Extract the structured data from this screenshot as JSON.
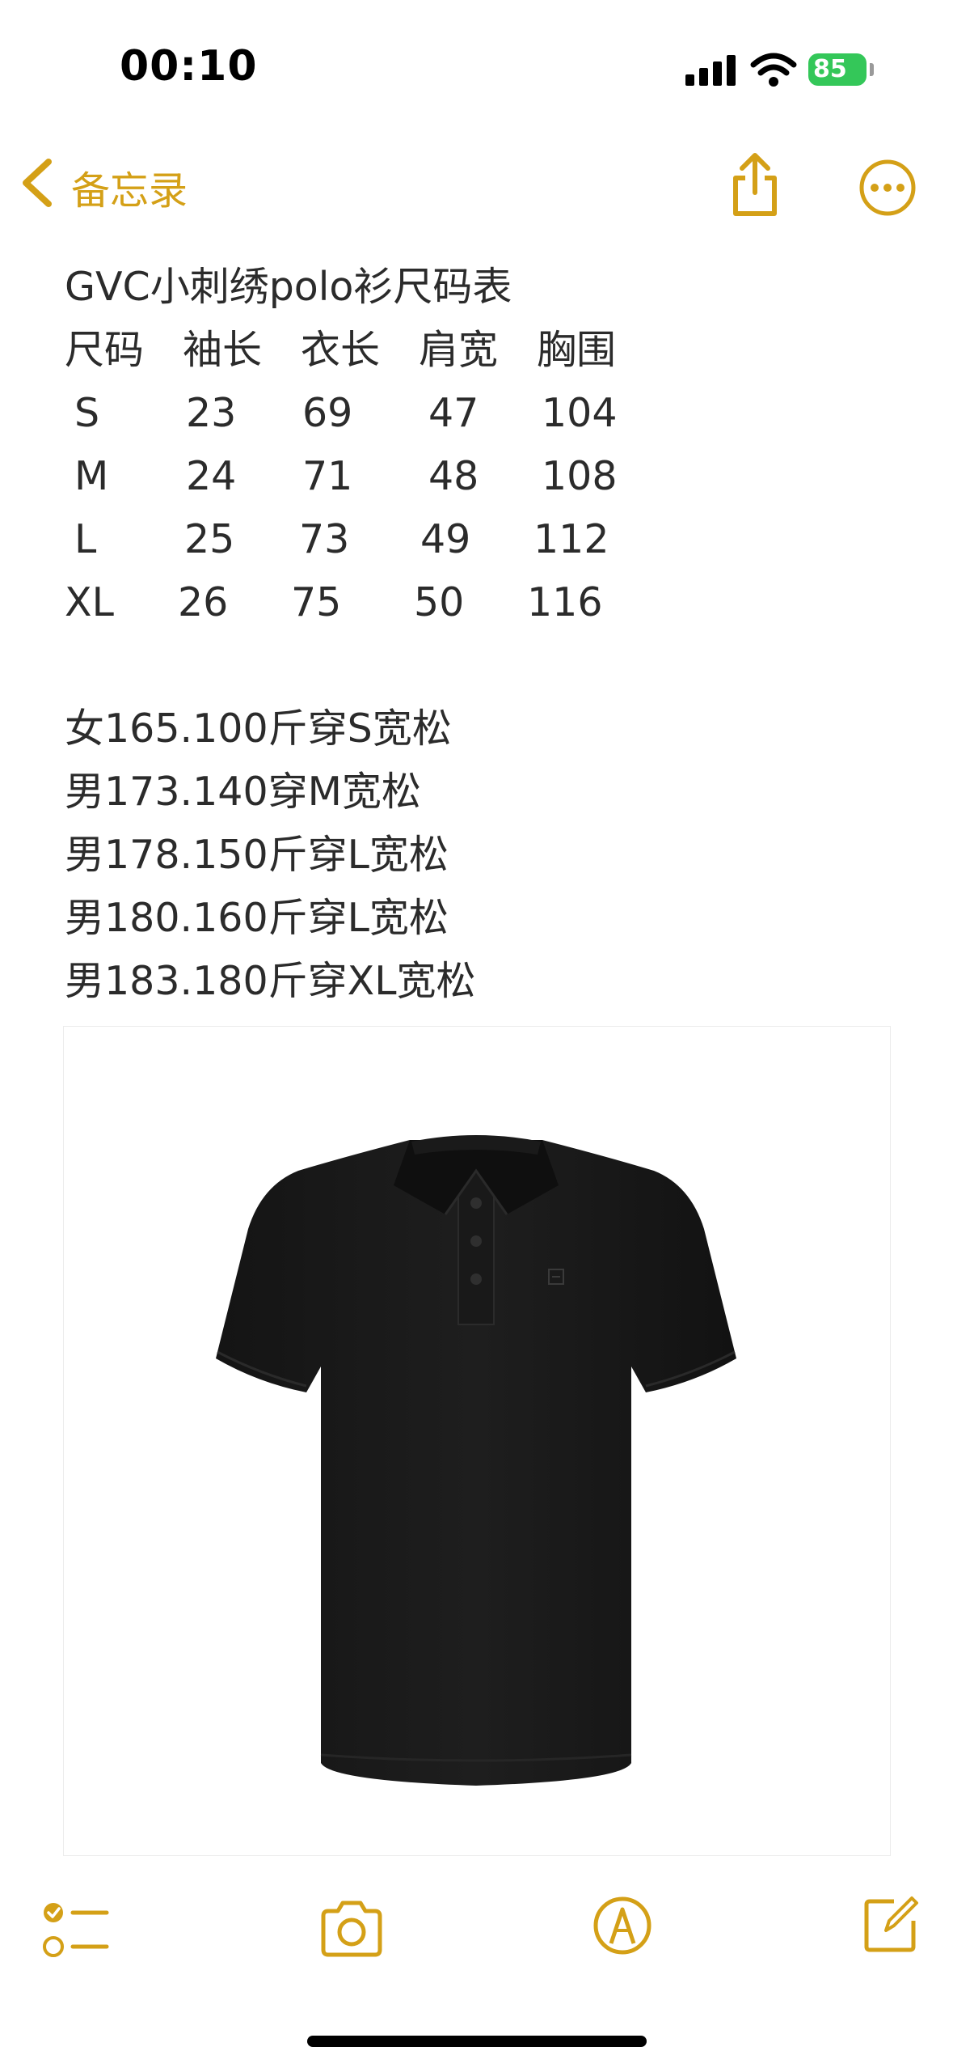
{
  "status_bar": {
    "time": "00:10",
    "battery": "85"
  },
  "nav": {
    "back_label": "备忘录"
  },
  "note": {
    "title": "GVC小刺绣polo衫尺码表",
    "size_table": {
      "headers": [
        "尺码",
        "袖长",
        "衣长",
        "肩宽",
        "胸围"
      ],
      "rows": [
        [
          "S",
          "23",
          "69",
          "47",
          "104"
        ],
        [
          "M",
          "24",
          "71",
          "48",
          "108"
        ],
        [
          "L",
          "25",
          "73",
          "49",
          "112"
        ],
        [
          "XL",
          "26",
          "75",
          "50",
          "116"
        ]
      ]
    },
    "recommendations": [
      "女165.100斤穿S宽松",
      "男173.140穿M宽松",
      "男178.150斤穿L宽松",
      "男180.160斤穿L宽松",
      "男183.180斤穿XL宽松"
    ]
  },
  "icons": {
    "back": "chevron-left-icon",
    "share": "share-icon",
    "more": "ellipsis-circle-icon",
    "checklist": "checklist-icon",
    "camera": "camera-icon",
    "markup": "markup-pen-icon",
    "compose": "compose-icon"
  },
  "colors": {
    "accent": "#d4a017",
    "text": "#2b2b2b",
    "battery": "#34c759"
  }
}
